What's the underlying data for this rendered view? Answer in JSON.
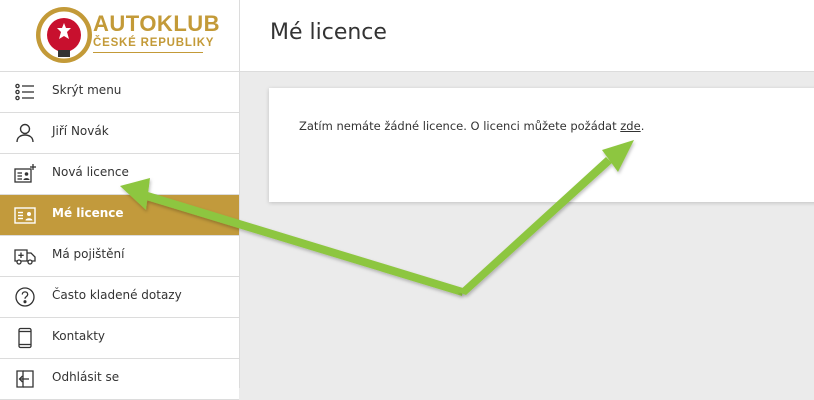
{
  "logo": {
    "title": "AUTOKLUB",
    "subtitle": "ČESKÉ REPUBLIKY",
    "brand_color": "#c39a38"
  },
  "sidebar": {
    "items": [
      {
        "label": "Skrýt menu",
        "icon": "list-icon",
        "active": false
      },
      {
        "label": "Jiří Novák",
        "icon": "user-icon",
        "active": false
      },
      {
        "label": "Nová licence",
        "icon": "add-license-icon",
        "active": false
      },
      {
        "label": "Mé licence",
        "icon": "license-card-icon",
        "active": true
      },
      {
        "label": "Má pojištění",
        "icon": "ambulance-icon",
        "active": false
      },
      {
        "label": "Často kladené dotazy",
        "icon": "question-icon",
        "active": false
      },
      {
        "label": "Kontakty",
        "icon": "phone-icon",
        "active": false
      },
      {
        "label": "Odhlásit se",
        "icon": "logout-icon",
        "active": false
      }
    ],
    "active_color": "#c29a3c"
  },
  "header": {
    "title": "Mé licence"
  },
  "main": {
    "message_prefix": "Zatím nemáte žádné licence. O licenci můžete požádat ",
    "link_text": "zde",
    "message_suffix": "."
  },
  "annotation": {
    "arrow_color": "#8dc63f",
    "arrow_icon": "arrow-icon"
  }
}
